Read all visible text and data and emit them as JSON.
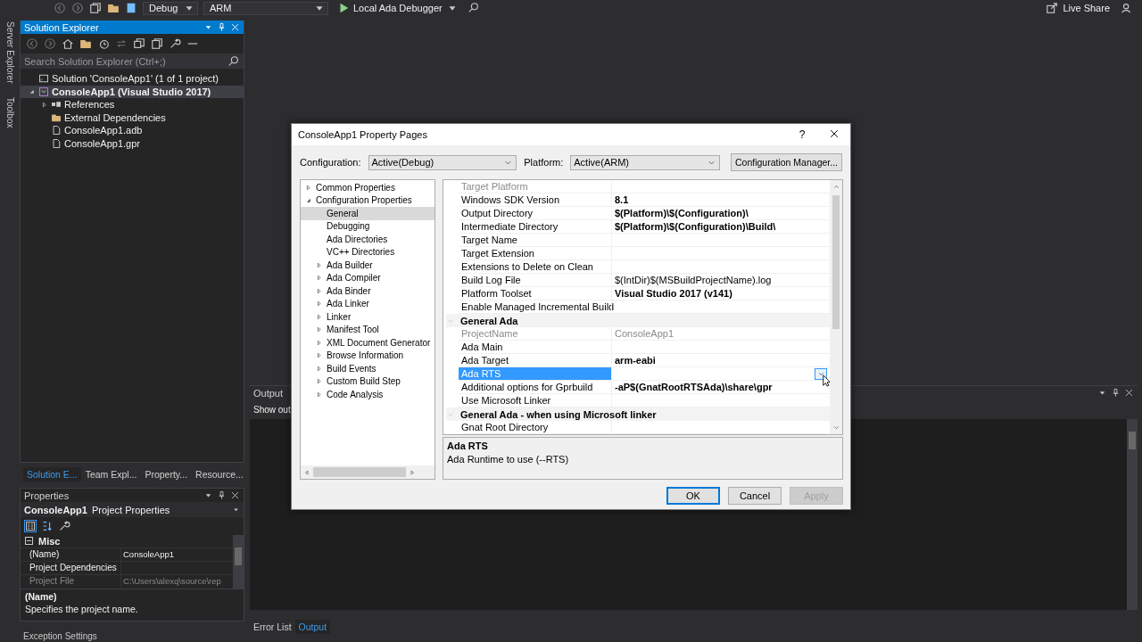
{
  "toolbar": {
    "items": [
      {
        "kind": "combo",
        "label": "Debug"
      },
      {
        "kind": "combo",
        "label": "ARM"
      },
      {
        "kind": "run",
        "label": "Local Ada Debugger"
      }
    ],
    "live_share": "Live Share"
  },
  "side_tabs": [
    "Server Explorer",
    "Toolbox"
  ],
  "solution_explorer": {
    "title": "Solution Explorer",
    "search": {
      "placeholder": "Search Solution Explorer (Ctrl+;)"
    },
    "tree": [
      {
        "kind": "solution",
        "label": "Solution 'ConsoleApp1' (1 of 1 project)",
        "selected": false,
        "children": [
          {
            "kind": "project",
            "label": "ConsoleApp1 (Visual Studio 2017)",
            "expanded": true,
            "selected": true,
            "children": [
              {
                "kind": "references",
                "label": "References",
                "expanded": false,
                "selected": false
              },
              {
                "kind": "folder",
                "label": "External Dependencies",
                "selected": false
              },
              {
                "kind": "file",
                "label": "ConsoleApp1.adb",
                "selected": false
              },
              {
                "kind": "file",
                "label": "ConsoleApp1.gpr",
                "selected": false
              }
            ]
          }
        ]
      }
    ]
  },
  "panel_tabs": [
    {
      "label": "Solution E...",
      "selected": true
    },
    {
      "label": "Team Expl...",
      "selected": false
    },
    {
      "label": "Property...",
      "selected": false
    },
    {
      "label": "Resource...",
      "selected": false
    }
  ],
  "properties": {
    "title": "Properties",
    "object": "ConsoleApp1",
    "object_type": "Project Properties",
    "grid": [
      {
        "kind": "category",
        "name": "Misc",
        "expanded": true
      },
      {
        "kind": "property",
        "name": "(Name)",
        "value": "ConsoleApp1",
        "disabled": false
      },
      {
        "kind": "property",
        "name": "Project Dependencies",
        "disabled": false
      },
      {
        "kind": "property",
        "name": "Project File",
        "value": "C:\\Users\\alexq\\source\\rep",
        "disabled": true
      }
    ],
    "description": {
      "title": "(Name)",
      "text": "Specifies the project name."
    }
  },
  "exception_settings": "Exception Settings",
  "output": {
    "title": "Output",
    "show_label": "Show out",
    "tabs": [
      {
        "label": "Error List",
        "selected": false
      },
      {
        "label": "Output",
        "selected": true
      }
    ]
  },
  "dialog": {
    "title": "ConsoleApp1 Property Pages",
    "help": "?",
    "configuration": {
      "label": "Configuration:",
      "value": "Active(Debug)"
    },
    "platform": {
      "label": "Platform:",
      "value": "Active(ARM)"
    },
    "manager_button": "Configuration Manager...",
    "tree": [
      {
        "label": "Common Properties",
        "expanded": false,
        "selected": false
      },
      {
        "label": "Configuration Properties",
        "expanded": true,
        "selected": false,
        "children": [
          {
            "label": "General",
            "selected": true
          },
          {
            "label": "Debugging",
            "selected": false
          },
          {
            "label": "Ada Directories",
            "selected": false
          },
          {
            "label": "VC++ Directories",
            "selected": false
          },
          {
            "label": "Ada Builder",
            "expanded": false,
            "selected": false
          },
          {
            "label": "Ada Compiler",
            "expanded": false,
            "selected": false
          },
          {
            "label": "Ada Binder",
            "expanded": false,
            "selected": false
          },
          {
            "label": "Ada Linker",
            "expanded": false,
            "selected": false
          },
          {
            "label": "Linker",
            "expanded": false,
            "selected": false
          },
          {
            "label": "Manifest Tool",
            "expanded": false,
            "selected": false
          },
          {
            "label": "XML Document Generator",
            "expanded": false,
            "selected": false
          },
          {
            "label": "Browse Information",
            "expanded": false,
            "selected": false
          },
          {
            "label": "Build Events",
            "expanded": false,
            "selected": false
          },
          {
            "label": "Custom Build Step",
            "expanded": false,
            "selected": false
          },
          {
            "label": "Code Analysis",
            "expanded": false,
            "selected": false
          }
        ]
      }
    ],
    "grid": [
      {
        "kind": "property",
        "name": "Target Platform",
        "disabled": true,
        "selected": false
      },
      {
        "kind": "property",
        "name": "Windows SDK Version",
        "value": "8.1",
        "bold": true,
        "disabled": false,
        "selected": false
      },
      {
        "kind": "property",
        "name": "Output Directory",
        "value": "$(Platform)\\$(Configuration)\\",
        "bold": true,
        "disabled": false,
        "selected": false
      },
      {
        "kind": "property",
        "name": "Intermediate Directory",
        "value": "$(Platform)\\$(Configuration)\\Build\\",
        "bold": true,
        "disabled": false,
        "selected": false
      },
      {
        "kind": "property",
        "name": "Target Name",
        "disabled": false,
        "selected": false
      },
      {
        "kind": "property",
        "name": "Target Extension",
        "disabled": false,
        "selected": false
      },
      {
        "kind": "property",
        "name": "Extensions to Delete on Clean",
        "disabled": false,
        "selected": false
      },
      {
        "kind": "property",
        "name": "Build Log File",
        "value": "$(IntDir)$(MSBuildProjectName).log",
        "bold": false,
        "disabled": false,
        "selected": false
      },
      {
        "kind": "property",
        "name": "Platform Toolset",
        "value": "Visual Studio 2017 (v141)",
        "bold": true,
        "disabled": false,
        "selected": false
      },
      {
        "kind": "property",
        "name": "Enable Managed Incremental Build",
        "disabled": false,
        "selected": false
      },
      {
        "kind": "category",
        "name": "General Ada",
        "expanded": true
      },
      {
        "kind": "property",
        "name": "ProjectName",
        "value": "ConsoleApp1",
        "bold": false,
        "disabled": true,
        "selected": false
      },
      {
        "kind": "property",
        "name": "Ada Main",
        "disabled": false,
        "selected": false
      },
      {
        "kind": "property",
        "name": "Ada Target",
        "value": "arm-eabi",
        "bold": true,
        "disabled": false,
        "selected": false
      },
      {
        "kind": "property",
        "name": "Ada RTS",
        "disabled": false,
        "selected": true
      },
      {
        "kind": "property",
        "name": "Additional options for Gprbuild",
        "value": "-aP$(GnatRootRTSAda)\\share\\gpr",
        "bold": true,
        "disabled": false,
        "selected": false
      },
      {
        "kind": "property",
        "name": "Use Microsoft Linker",
        "disabled": false,
        "selected": false
      },
      {
        "kind": "category",
        "name": "General Ada - when using Microsoft linker",
        "expanded": true
      },
      {
        "kind": "property",
        "name": "Gnat Root Directory",
        "disabled": false,
        "selected": false
      }
    ],
    "description": {
      "title": "Ada RTS",
      "text": "Ada Runtime to use (--RTS)"
    },
    "buttons": [
      {
        "kind": "default",
        "label": "OK",
        "disabled": false
      },
      {
        "kind": "normal",
        "label": "Cancel",
        "disabled": false
      },
      {
        "kind": "normal",
        "label": "Apply",
        "disabled": true
      }
    ]
  }
}
